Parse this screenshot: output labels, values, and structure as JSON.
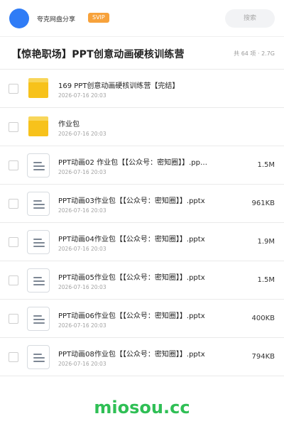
{
  "header": {
    "user_name": "夸克网盘分享",
    "vip_label": "SVIP",
    "search_placeholder": "搜索"
  },
  "folder": {
    "title": "【惊艳职场】PPT创意动画硬核训练营",
    "meta": "共 64 项 · 2.7G"
  },
  "files": [
    {
      "type": "folder",
      "name": "169 PPT创意动画硬核训练营【完结】",
      "date": "2026-07-16 20:03",
      "size": ""
    },
    {
      "type": "folder",
      "name": "作业包",
      "date": "2026-07-16 20:03",
      "size": ""
    },
    {
      "type": "file",
      "name": "PPT动画02 作业包【【公众号：密知圈】】.pp…",
      "date": "2026-07-16 20:03",
      "size": "1.5M"
    },
    {
      "type": "file",
      "name": "PPT动画03作业包【【公众号：密知圈】】.pptx",
      "date": "2026-07-16 20:03",
      "size": "961KB"
    },
    {
      "type": "file",
      "name": "PPT动画04作业包【【公众号：密知圈】】.pptx",
      "date": "2026-07-16 20:03",
      "size": "1.9M"
    },
    {
      "type": "file",
      "name": "PPT动画05作业包【【公众号：密知圈】】.pptx",
      "date": "2026-07-16 20:03",
      "size": "1.5M"
    },
    {
      "type": "file",
      "name": "PPT动画06作业包【【公众号：密知圈】】.pptx",
      "date": "2026-07-16 20:03",
      "size": "400KB"
    },
    {
      "type": "file",
      "name": "PPT动画08作业包【【公众号：密知圈】】.pptx",
      "date": "2026-07-16 20:03",
      "size": "794KB"
    }
  ],
  "watermark": "miosou.cc",
  "colors": {
    "accent": "#2f7cf6",
    "vip": "#f7a23b",
    "folder": "#f7c21b",
    "watermark": "#2fbf55"
  }
}
